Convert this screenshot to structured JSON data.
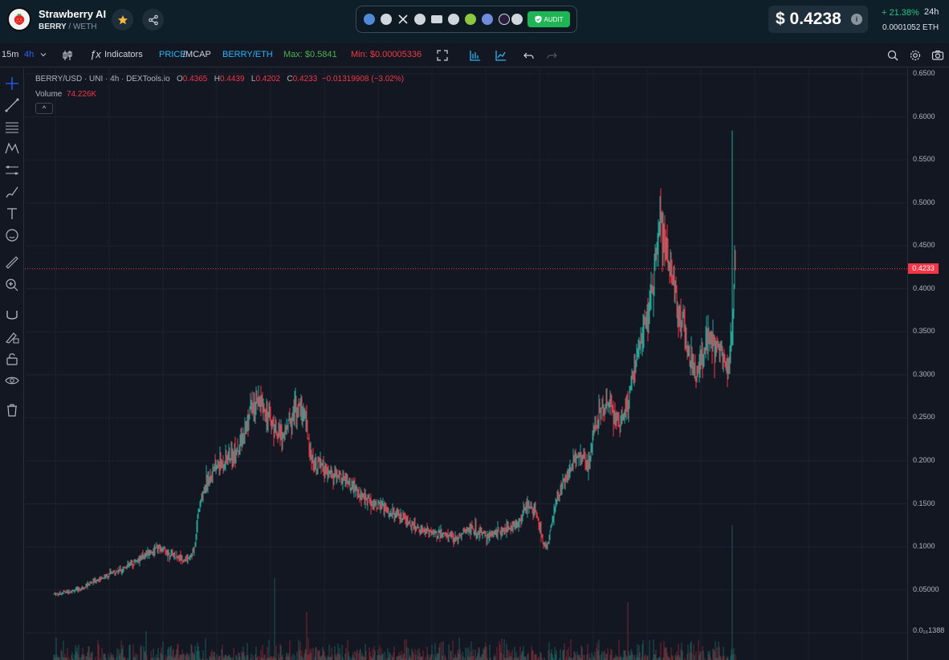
{
  "header": {
    "token_name": "Strawberry AI",
    "pair_base": "BERRY",
    "pair_quote": "/ WETH",
    "audit_label": "AUDIT",
    "price": "$ 0.4238",
    "info_glyph": "i",
    "change_pct": "+ 21.38%",
    "change_period": "24h",
    "eth_price": "0.0001052 ETH",
    "links": [
      "dextools-icon",
      "website-icon",
      "x-icon",
      "telegram-icon",
      "email-icon",
      "reddit-icon",
      "coingecko-icon",
      "coinmarketcap-icon",
      "other-icon",
      "more-icon"
    ]
  },
  "toolbar": {
    "interval_15m": "15m",
    "interval_4h": "4h",
    "indicators": "Indicators",
    "price_label": "PRICE",
    "mcap_label": "/MCAP",
    "pair_label": "BERRY/ETH",
    "max_label": "Max: $0.5841",
    "min_label": "Min: $0.00005336"
  },
  "legend": {
    "symbol": "BERRY/USD · UNI · 4h · DEXTools.io",
    "o_label": "O",
    "o_val": "0.4365",
    "h_label": "H",
    "h_val": "0.4439",
    "l_label": "L",
    "l_val": "0.4202",
    "c_label": "C",
    "c_val": "0.4233",
    "change": "−0.01319908 (−3.02%)",
    "volume_label": "Volume",
    "volume_val": "74.226K",
    "collapse_glyph": "^"
  },
  "price_axis": {
    "labels": [
      "0.6500",
      "0.6000",
      "0.5500",
      "0.5000",
      "0.4500",
      "0.4000",
      "0.3500",
      "0.3000",
      "0.2500",
      "0.2000",
      "0.1500",
      "0.1000",
      "0.05000",
      "0.0₁₆1388"
    ],
    "current_price": "0.4233"
  },
  "colors": {
    "up": "#26a69a",
    "down": "#f23645",
    "background": "#131722",
    "header": "#0f1f2a"
  },
  "chart_data": {
    "type": "candlestick",
    "ylim": [
      0.0,
      0.65
    ],
    "current": 0.4233,
    "max": 0.5841,
    "anchors": [
      [
        0,
        0.045
      ],
      [
        30,
        0.05
      ],
      [
        50,
        0.06
      ],
      [
        75,
        0.07
      ],
      [
        100,
        0.082
      ],
      [
        115,
        0.092
      ],
      [
        130,
        0.098
      ],
      [
        150,
        0.09
      ],
      [
        165,
        0.085
      ],
      [
        175,
        0.095
      ],
      [
        180,
        0.142
      ],
      [
        190,
        0.178
      ],
      [
        205,
        0.195
      ],
      [
        220,
        0.205
      ],
      [
        235,
        0.222
      ],
      [
        245,
        0.26
      ],
      [
        260,
        0.266
      ],
      [
        270,
        0.245
      ],
      [
        285,
        0.228
      ],
      [
        300,
        0.262
      ],
      [
        312,
        0.258
      ],
      [
        320,
        0.205
      ],
      [
        340,
        0.185
      ],
      [
        360,
        0.18
      ],
      [
        380,
        0.16
      ],
      [
        400,
        0.15
      ],
      [
        420,
        0.14
      ],
      [
        440,
        0.128
      ],
      [
        460,
        0.12
      ],
      [
        480,
        0.115
      ],
      [
        500,
        0.11
      ],
      [
        520,
        0.122
      ],
      [
        540,
        0.112
      ],
      [
        560,
        0.12
      ],
      [
        580,
        0.128
      ],
      [
        590,
        0.15
      ],
      [
        600,
        0.14
      ],
      [
        610,
        0.103
      ],
      [
        615,
        0.102
      ],
      [
        625,
        0.15
      ],
      [
        640,
        0.185
      ],
      [
        655,
        0.21
      ],
      [
        665,
        0.19
      ],
      [
        675,
        0.25
      ],
      [
        690,
        0.27
      ],
      [
        705,
        0.245
      ],
      [
        715,
        0.265
      ],
      [
        730,
        0.342
      ],
      [
        745,
        0.39
      ],
      [
        755,
        0.48
      ],
      [
        765,
        0.44
      ],
      [
        775,
        0.39
      ],
      [
        790,
        0.33
      ],
      [
        800,
        0.3
      ],
      [
        815,
        0.345
      ],
      [
        830,
        0.325
      ],
      [
        840,
        0.31
      ],
      [
        845,
        0.36
      ],
      [
        848,
        0.4233
      ]
    ],
    "volume_spikes": [
      [
        115,
        0.3
      ],
      [
        275,
        0.85
      ],
      [
        315,
        0.5
      ],
      [
        715,
        0.6
      ],
      [
        760,
        0.2
      ],
      [
        845,
        1.4
      ]
    ]
  }
}
